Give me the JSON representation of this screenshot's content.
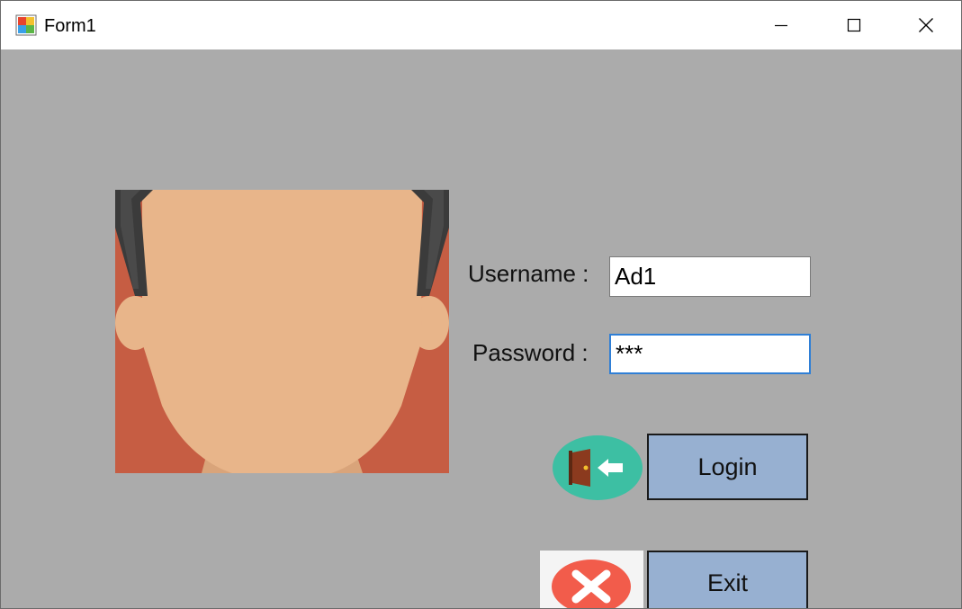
{
  "window": {
    "title": "Form1",
    "icon": "winforms-app-icon",
    "controls": {
      "minimize": "minimize-icon",
      "maximize": "maximize-icon",
      "close": "close-icon"
    }
  },
  "form": {
    "avatar": "person-face-picture",
    "username": {
      "label": "Username :",
      "value": "Ad1"
    },
    "password": {
      "label": "Password :",
      "value": "***"
    },
    "login_button": {
      "label": "Login",
      "icon": "door-enter-icon"
    },
    "exit_button": {
      "label": "Exit",
      "icon": "red-x-icon"
    }
  },
  "colors": {
    "form_background": "#ababab",
    "button_background": "#97b0d1",
    "login_icon_circle": "#3dbfa3",
    "exit_icon_circle": "#f25c4b",
    "face_skin": "#e8b58a",
    "face_background": "#c65d43"
  }
}
